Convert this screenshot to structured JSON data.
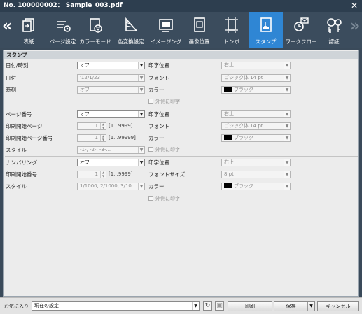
{
  "window": {
    "title": "No. 100000002： Sample_003.pdf"
  },
  "tabs": [
    {
      "label": "表紙",
      "icon": "cover-icon"
    },
    {
      "label": "ページ設定",
      "icon": "page-settings-icon"
    },
    {
      "label": "カラーモード",
      "icon": "color-mode-icon"
    },
    {
      "label": "色変換設定",
      "icon": "color-conversion-icon"
    },
    {
      "label": "イメージング",
      "icon": "imaging-icon"
    },
    {
      "label": "画像位置",
      "icon": "image-position-icon"
    },
    {
      "label": "トンボ",
      "icon": "crop-marks-icon"
    },
    {
      "label": "スタンプ",
      "icon": "stamp-icon",
      "active": true
    },
    {
      "label": "ワークフロー",
      "icon": "workflow-icon"
    },
    {
      "label": "認証",
      "icon": "authentication-icon"
    }
  ],
  "section": {
    "title": "スタンプ"
  },
  "datetime": {
    "label": "日付/時刻",
    "value": "オフ",
    "date_label": "日付",
    "date_value": "'12/1/23",
    "time_label": "時刻",
    "time_value": "オフ",
    "position_label": "印字位置",
    "position_value": "右上",
    "font_label": "フォント",
    "font_value": "ゴシック体 14 pt",
    "color_label": "カラー",
    "color_value": "ブラック",
    "outside_label": "外側に印字"
  },
  "page_number": {
    "label": "ページ番号",
    "value": "オフ",
    "start_page_label": "印刷開始ページ",
    "start_page_value": "1",
    "start_page_range": "[1...9999]",
    "start_num_label": "印刷開始ページ番号",
    "start_num_value": "1",
    "start_num_range": "[1...99999]",
    "style_label": "スタイル",
    "style_value": "-1-, -2-, -3-...",
    "position_label": "印字位置",
    "position_value": "右上",
    "font_label": "フォント",
    "font_value": "ゴシック体 14 pt",
    "color_label": "カラー",
    "color_value": "ブラック",
    "outside_label": "外側に印字"
  },
  "numbering": {
    "label": "ナンバリング",
    "value": "オフ",
    "start_num_label": "印刷開始番号",
    "start_num_value": "1",
    "start_num_range": "[1...9999]",
    "style_label": "スタイル",
    "style_value": "1/1000, 2/1000, 3/10...",
    "position_label": "印字位置",
    "position_value": "右上",
    "fontsize_label": "フォントサイズ",
    "fontsize_value": "8 pt",
    "color_label": "カラー",
    "color_value": "ブラック",
    "outside_label": "外側に印字"
  },
  "footer": {
    "favorites_label": "お気に入り",
    "favorites_value": "現在の設定",
    "print_label": "印刷",
    "save_label": "保存",
    "cancel_label": "キャンセル"
  },
  "colors": {
    "active_tab": "#2f86d4",
    "toolbar": "#3b4c5d",
    "titlebar": "#2d3e4f"
  }
}
